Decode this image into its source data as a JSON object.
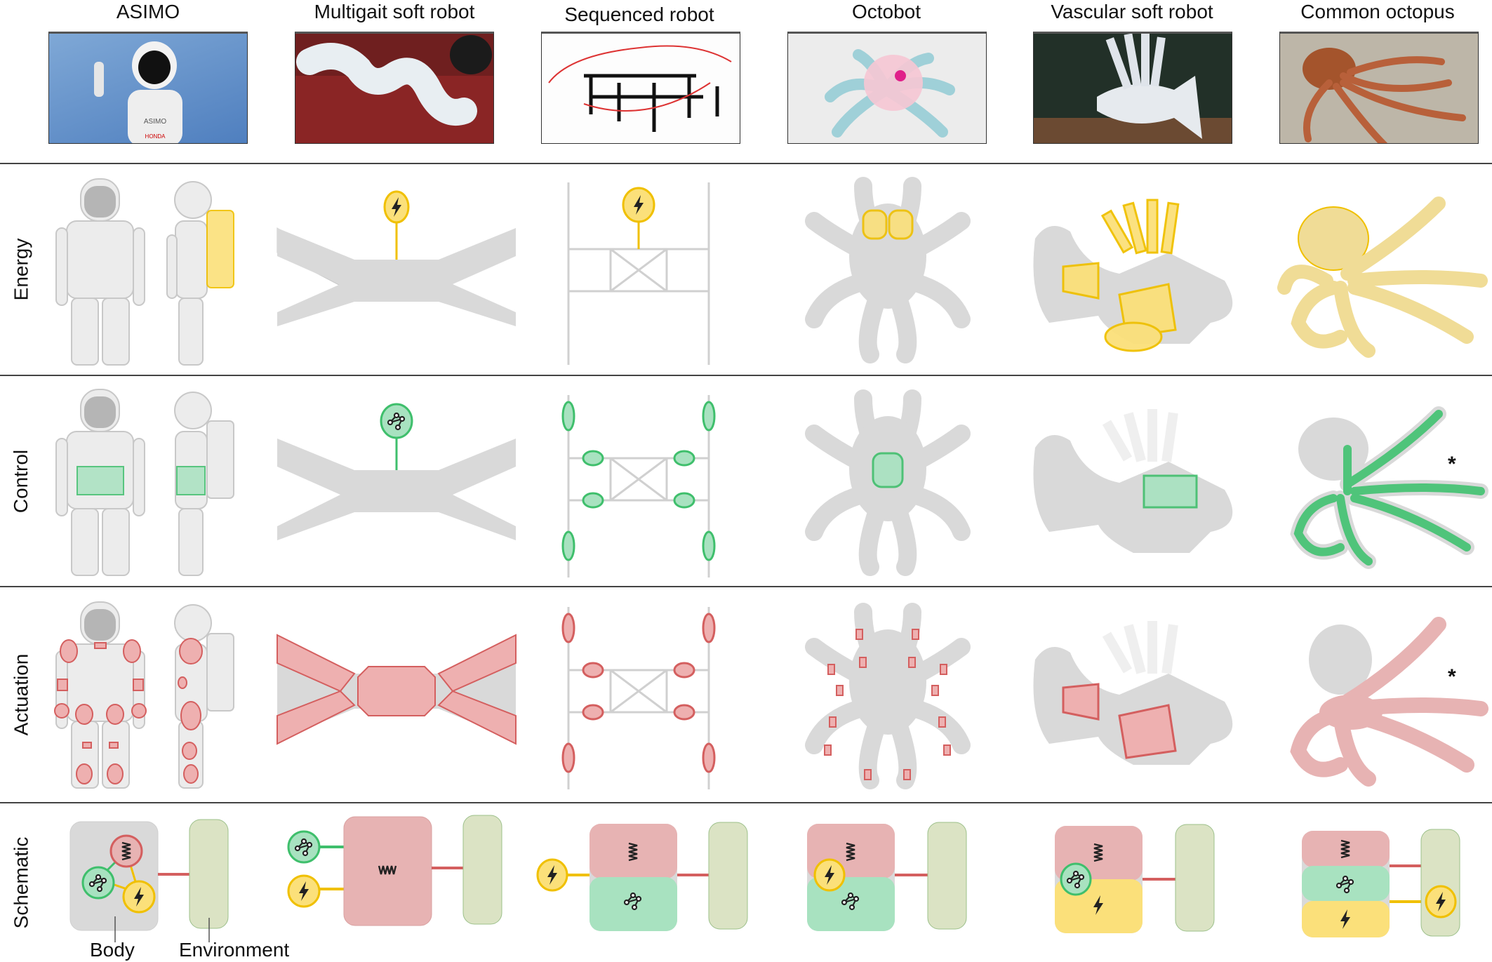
{
  "columns": [
    {
      "title": "ASIMO",
      "photo": "asimo-photo"
    },
    {
      "title": "Multigait soft robot",
      "photo": "multigait-photo"
    },
    {
      "title": "Sequenced robot",
      "photo": "sequenced-photo"
    },
    {
      "title": "Octobot",
      "photo": "octobot-photo"
    },
    {
      "title": "Vascular soft robot",
      "photo": "vascular-photo"
    },
    {
      "title": "Common octopus",
      "photo": "octopus-photo"
    }
  ],
  "rows": [
    {
      "label": "Energy",
      "highlight_color": "#f0c400"
    },
    {
      "label": "Control",
      "highlight_color": "#4fc47a"
    },
    {
      "label": "Actuation",
      "highlight_color": "#d9606a"
    },
    {
      "label": "Schematic"
    }
  ],
  "annotations": {
    "asterisk": "*",
    "body_label": "Body",
    "environment_label": "Environment"
  },
  "colors": {
    "energy_fill": "#fbe07a",
    "energy_stroke": "#f0c000",
    "control_fill": "#a8e2c0",
    "control_stroke": "#3fbf6c",
    "actuation_fill": "#e7b3b3",
    "actuation_stroke": "#d45f5f",
    "body_gray": "#d9d9d9",
    "environment_fill": "#dbe3c4",
    "environment_stroke": "#9cc08a"
  },
  "icons": {
    "energy": "lightning-bolt-icon",
    "control": "network-graph-icon",
    "actuation": "spring-icon"
  }
}
